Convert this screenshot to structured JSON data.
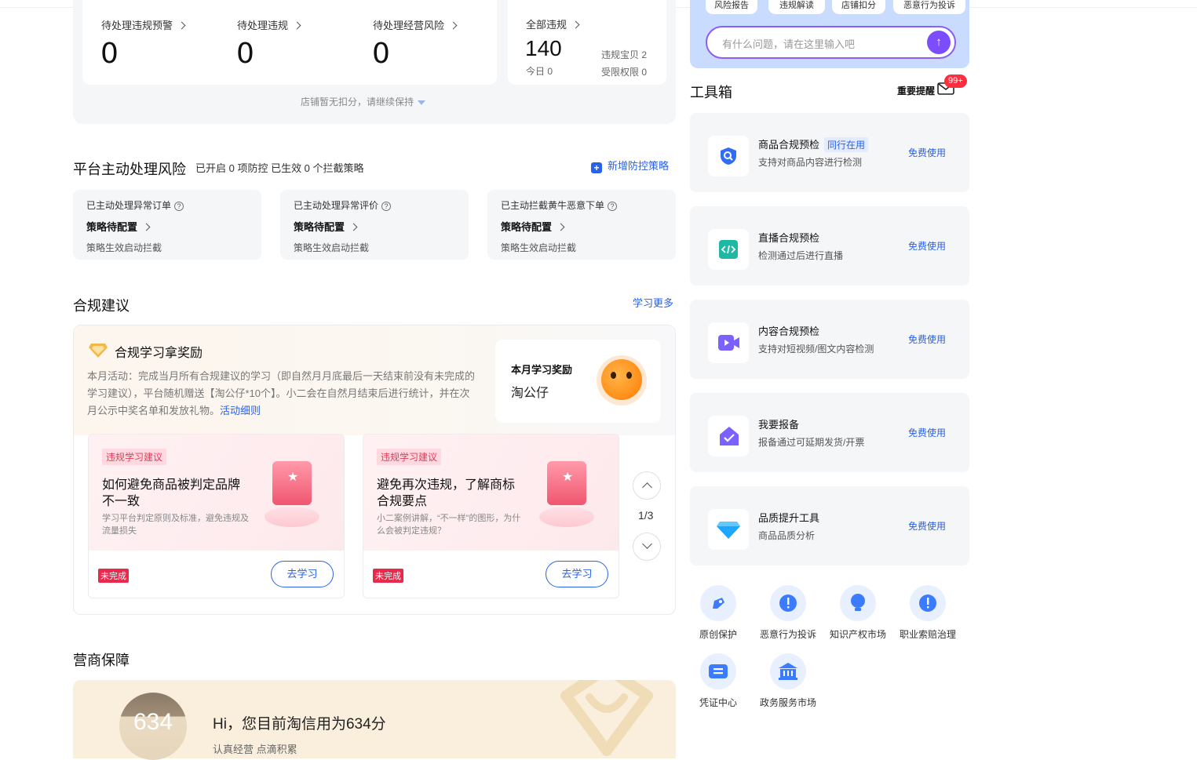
{
  "violations": {
    "items": [
      {
        "label": "待处理违规预警",
        "value": "0"
      },
      {
        "label": "待处理违规",
        "value": "0"
      },
      {
        "label": "待处理经营风险",
        "value": "0"
      }
    ],
    "all": {
      "label": "全部违规",
      "value": "140",
      "today": "今日 0",
      "goods": "违规宝贝 2",
      "limit": "受限权限 0"
    },
    "note": "店铺暂无扣分，请继续保持"
  },
  "platform_risk": {
    "title": "平台主动处理风险",
    "subtitle": "已开启 0 项防控 已生效 0 个拦截策略",
    "add_label": "新增防控策略",
    "cards": [
      {
        "title": "已主动处理异常订单",
        "status": "策略待配置",
        "desc": "策略生效启动拦截"
      },
      {
        "title": "已主动处理异常评价",
        "status": "策略待配置",
        "desc": "策略生效启动拦截"
      },
      {
        "title": "已主动拦截黄牛恶意下单",
        "status": "策略待配置",
        "desc": "策略生效启动拦截"
      }
    ]
  },
  "compliance": {
    "title": "合规建议",
    "more_label": "学习更多",
    "reward_title": "合规学习拿奖励",
    "reward_desc": "本月活动：完成当月所有合规建议的学习（即自然月月底最后一天结束前没有未完成的学习建议），平台随机赠送【淘公仔*10个】。小二会在自然月结束后进行统计，并在次月公示中奖名单和发放礼物。",
    "reward_link": "活动细则",
    "award_label": "本月学习奖励",
    "award_value": "淘公仔",
    "cards": [
      {
        "tag": "违规学习建议",
        "title": "如何避免商品被判定品牌不一致",
        "desc": "学习平台判定原则及标准，避免违规及流量损失",
        "status": "未完成",
        "button": "去学习"
      },
      {
        "tag": "违规学习建议",
        "title": "避免再次违规，了解商标合规要点",
        "desc": "小二案例讲解，“不一样”的图形，为什么会被判定违规？",
        "status": "未完成",
        "button": "去学习"
      }
    ],
    "pager": "1/3"
  },
  "guarantee": {
    "title": "营商保障",
    "score": "634",
    "greeting": "Hi，您目前淘信用为634分",
    "slogan": "认真经营 点滴积累"
  },
  "assistant": {
    "chips": [
      "风险报告",
      "违规解读",
      "店铺扣分",
      "恶意行为投诉"
    ],
    "placeholder": "有什么问题，请在这里输入吧",
    "send_icon": "arrow-up-icon"
  },
  "toolbox": {
    "title": "工具箱",
    "reminder_label": "重要提醒",
    "reminder_badge": "99+",
    "tools": [
      {
        "name": "商品合规预检",
        "tag": "同行在用",
        "desc": "支持对商品内容进行检测",
        "action": "免费使用",
        "icon": "shield-search-icon",
        "color": "#2f6df6"
      },
      {
        "name": "直播合规预检",
        "tag": "",
        "desc": "检测通过后进行直播",
        "action": "免费使用",
        "icon": "code-icon",
        "color": "#1fb8a3"
      },
      {
        "name": "内容合规预检",
        "tag": "",
        "desc": "支持对短视频/图文内容检测",
        "action": "免费使用",
        "icon": "video-icon",
        "color": "#7b61ff"
      },
      {
        "name": "我要报备",
        "tag": "",
        "desc": "报备通过可延期发货/开票",
        "action": "免费使用",
        "icon": "report-check-icon",
        "color": "#7b61ff"
      },
      {
        "name": "品质提升工具",
        "tag": "",
        "desc": "商品品质分析",
        "action": "免费使用",
        "icon": "diamond-icon",
        "color": "#1ea7ff"
      }
    ],
    "shortcuts": [
      {
        "label": "原创保护",
        "icon": "original-protect-icon"
      },
      {
        "label": "恶意行为投诉",
        "icon": "exclamation-icon"
      },
      {
        "label": "知识产权市场",
        "icon": "bulb-icon"
      },
      {
        "label": "职业索赔治理",
        "icon": "exclamation-icon"
      },
      {
        "label": "凭证中心",
        "icon": "voucher-icon"
      },
      {
        "label": "政务服务市场",
        "icon": "government-icon"
      }
    ]
  },
  "colors": {
    "accent": "#2a61e6",
    "purple": "#7c4dff",
    "danger": "#e8294c"
  }
}
